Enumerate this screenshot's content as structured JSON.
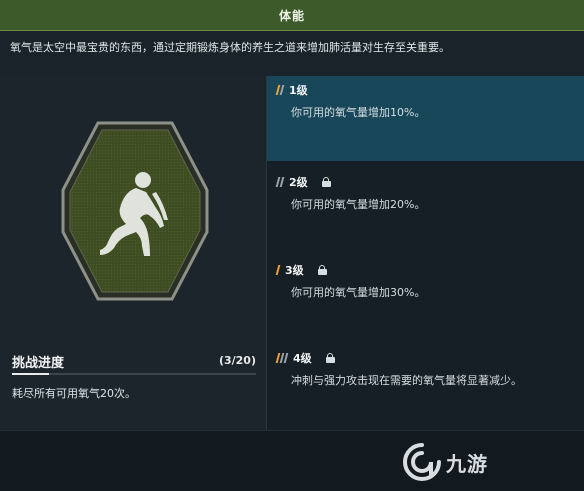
{
  "header": {
    "title": "体能"
  },
  "description": "氧气是太空中最宝贵的东西，通过定期锻炼身体的养生之道来增加肺活量对生存至关重要。",
  "badge": {
    "icon": "crouching-figure-icon"
  },
  "progress": {
    "title": "挑战进度",
    "count": "(3/20)",
    "fraction": 0.15,
    "description": "耗尽所有可用氧气20次。"
  },
  "levels": [
    {
      "name": "1级",
      "locked": false,
      "active": true,
      "description": "你可用的氧气量增加10%。"
    },
    {
      "name": "2级",
      "locked": true,
      "active": false,
      "description": "你可用的氧气量增加20%。"
    },
    {
      "name": "3级",
      "locked": true,
      "active": false,
      "description": "你可用的氧气量增加30%。"
    },
    {
      "name": "4级",
      "locked": true,
      "active": false,
      "description": "冲刺与强力攻击现在需要的氧气量将显著减少。"
    }
  ],
  "colors": {
    "header_bg": "#3d5a2a",
    "active_level_bg": "#19475a",
    "bar_orange": "#f0a030",
    "bar_gray": "#9aa4aa",
    "badge_green": "#3e4e22"
  },
  "watermark": {
    "text": "九游",
    "icon": "nine-game-logo-icon"
  }
}
